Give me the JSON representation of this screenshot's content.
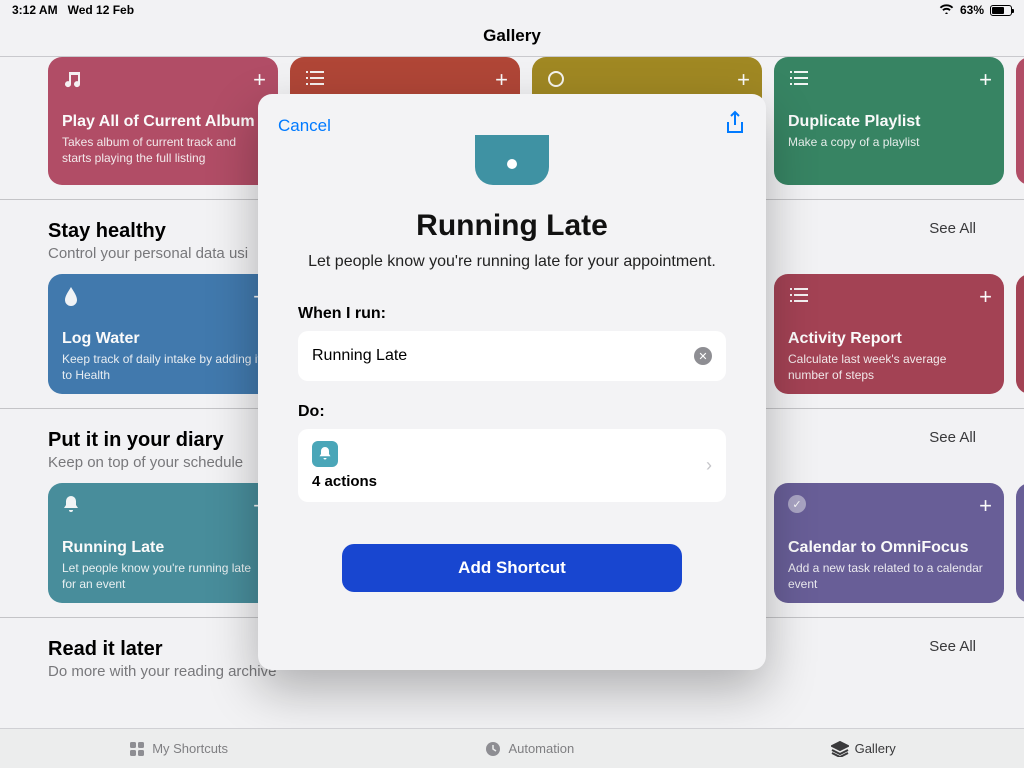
{
  "status": {
    "time": "3:12 AM",
    "date": "Wed 12 Feb",
    "battery_pct": "63%"
  },
  "page_title": "Gallery",
  "see_all": "See All",
  "top_cards": [
    {
      "title": "Play All of Current Album",
      "subtitle": "Takes album of current track and starts playing the full listing",
      "color": "#c24a68"
    },
    {
      "title": "",
      "subtitle": "",
      "color": "#c34432"
    },
    {
      "title": "",
      "subtitle": "",
      "color": "#a88b12"
    },
    {
      "title": "Duplicate Playlist",
      "subtitle": "Make a copy of a playlist",
      "color": "#2e8a63"
    }
  ],
  "right_sliver_colors": {
    "top": "#c24a68",
    "health": "#b43f55",
    "diary": "#6b5fa3"
  },
  "sections": [
    {
      "title": "Stay healthy",
      "subtitle": "Control your personal data usi",
      "cards": [
        {
          "title": "Log Water",
          "subtitle": "Keep track of daily intake by adding it to Health",
          "color": "#3a7dbb",
          "icon": "drop"
        },
        {
          "title": "Activity Report",
          "subtitle": "Calculate last week's average number of steps",
          "color": "#b43f55",
          "icon": "list"
        }
      ]
    },
    {
      "title": "Put it in your diary",
      "subtitle": "Keep on top of your schedule",
      "cards": [
        {
          "title": "Running Late",
          "subtitle": "Let people know you're running late for an event",
          "color": "#3f92a3",
          "icon": "bell"
        },
        {
          "title": "Calendar to OmniFocus",
          "subtitle": "Add a new task related to a calendar event",
          "color": "#6b5fa3",
          "icon": "check"
        }
      ]
    },
    {
      "title": "Read it later",
      "subtitle": "Do more with your reading archive",
      "cards": []
    }
  ],
  "modal": {
    "cancel": "Cancel",
    "title": "Running Late",
    "subtitle": "Let people know you're running late for your appointment.",
    "when_label": "When I run:",
    "shortcut_name": "Running Late",
    "do_label": "Do:",
    "actions_count": "4 actions",
    "add_button": "Add Shortcut"
  },
  "tabs": {
    "my": "My Shortcuts",
    "auto": "Automation",
    "gallery": "Gallery"
  }
}
